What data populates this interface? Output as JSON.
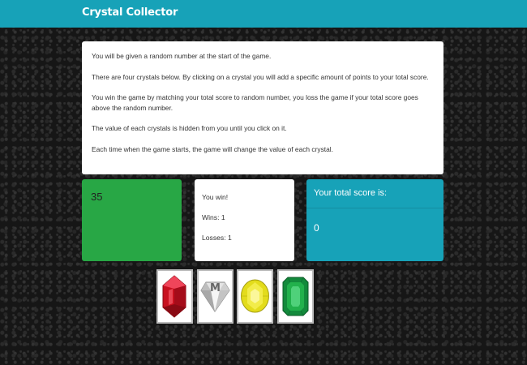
{
  "navbar": {
    "brand": "Crystal Collector"
  },
  "instructions": [
    "You will be given a random number at the start of the game.",
    "There are four crystals below. By clicking on a crystal you will add a specific amount of points to your total score.",
    "You win the game by matching your total score to random number, you loss the game if your total score goes above the random number.",
    "The value of each crystals is hidden from you until you click on it.",
    "Each time when the game starts, the game will change the value of each crystal."
  ],
  "game": {
    "random_number": "35",
    "result": "You win!",
    "wins": "Wins: 1",
    "losses": "Losses: 1",
    "score_title": "Your total score is:",
    "score": "0"
  },
  "crystals": [
    {
      "icon": "red-ruby-crystal-icon",
      "color": "#e0182b"
    },
    {
      "icon": "clear-diamond-crystal-icon",
      "color": "#c8c8c8"
    },
    {
      "icon": "yellow-citrine-crystal-icon",
      "color": "#e6e020"
    },
    {
      "icon": "green-emerald-crystal-icon",
      "color": "#1fa34a"
    }
  ],
  "colors": {
    "navbar": "#17a2b8",
    "target": "#28a745",
    "score_panel": "#17a2b8"
  }
}
